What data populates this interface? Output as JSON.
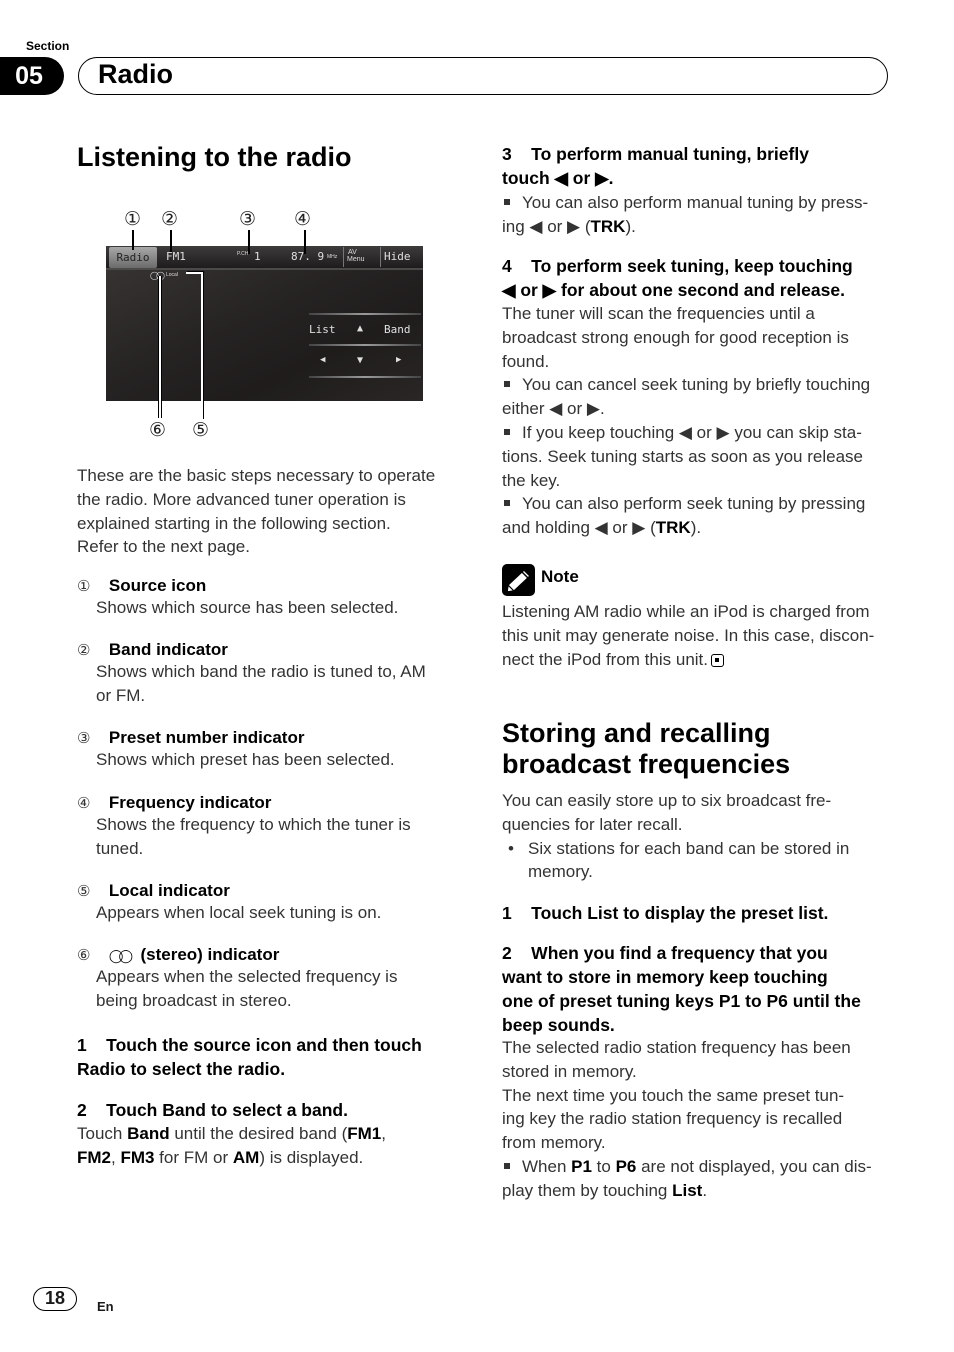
{
  "header": {
    "section_label": "Section",
    "section_number": "05",
    "section_title": "Radio"
  },
  "left": {
    "title": "Listening to the radio",
    "figure": {
      "callouts_top": [
        "①",
        "②",
        "③",
        "④"
      ],
      "callouts_bottom": [
        "⑥",
        "⑤"
      ],
      "screen": {
        "source_button": "Radio",
        "band": "FM1",
        "preset_label": "P.CH",
        "preset_value": "1",
        "frequency": "87. 9",
        "frequency_unit": "MHz",
        "av_menu_line1": "AV",
        "av_menu_line2": "Menu",
        "hide": "Hide",
        "local": "Local",
        "list": "List",
        "up_arrow": "▲",
        "band_button": "Band",
        "left_arrow": "◀",
        "down_arrow": "▼",
        "right_arrow": "▶"
      }
    },
    "intro": [
      "These are the basic steps necessary to operate",
      "the radio. More advanced tuner operation is",
      "explained starting in the following section.",
      "Refer to the next page."
    ],
    "items": [
      {
        "num": "①",
        "head": "Source icon",
        "lines": [
          "Shows which source has been selected."
        ]
      },
      {
        "num": "②",
        "head": "Band indicator",
        "lines": [
          "Shows which band the radio is tuned to, AM",
          "or FM."
        ]
      },
      {
        "num": "③",
        "head": "Preset number indicator",
        "lines": [
          "Shows which preset has been selected."
        ]
      },
      {
        "num": "④",
        "head": "Frequency indicator",
        "lines": [
          "Shows the frequency to which the tuner is",
          "tuned."
        ]
      },
      {
        "num": "⑤",
        "head": "Local indicator",
        "lines": [
          "Appears when local seek tuning is on."
        ]
      },
      {
        "num": "⑥",
        "head": "(stereo) indicator",
        "stereo_glyph": "◯◯",
        "lines": [
          "Appears when the selected frequency is",
          "being broadcast in stereo."
        ]
      }
    ],
    "step1": {
      "line1": "1    Touch the source icon and then touch",
      "line2": "Radio to select the radio."
    },
    "step2": {
      "head": "2    Touch Band to select a band.",
      "t1": "Touch ",
      "b1": "Band",
      "t2": " until the desired band (",
      "b2": "FM1",
      "t3": ",",
      "b3": "FM2",
      "t4": ", ",
      "b4": "FM3",
      "t5": " for FM or ",
      "b5": "AM",
      "t6": ") is displayed."
    }
  },
  "right": {
    "step3": {
      "line1": "3    To perform manual tuning, briefly",
      "line2": "touch ◀ or ▶.",
      "bullet_l1": "You can also perform manual tuning by press-",
      "bullet_l2a": "ing ◀ or ▶ (",
      "bullet_l2b": "TRK",
      "bullet_l2c": ")."
    },
    "step4": {
      "line1": "4    To perform seek tuning, keep touching",
      "line2": "◀ or ▶ for about one second and release.",
      "body": [
        "The tuner will scan the frequencies until a",
        "broadcast strong enough for good reception is",
        "found."
      ],
      "bullets": [
        [
          "You can cancel seek tuning by briefly touching",
          "either ◀ or ▶."
        ],
        [
          "If you keep touching ◀ or ▶ you can skip sta-",
          "tions. Seek tuning starts as soon as you release",
          "the key."
        ]
      ],
      "bullet3_l1": "You can also perform seek tuning by pressing",
      "bullet3_l2a": "and holding ◀ or ▶ (",
      "bullet3_l2b": "TRK",
      "bullet3_l2c": ")."
    },
    "note": {
      "label": "Note",
      "lines": [
        "Listening AM radio while an iPod is charged from",
        "this unit may generate noise. In this case, discon-",
        "nect the iPod from this unit."
      ]
    },
    "section2": {
      "title_l1": "Storing and recalling",
      "title_l2": "broadcast frequencies",
      "intro": [
        "You can easily store up to six broadcast fre-",
        "quencies for later recall."
      ],
      "dot_bullet": [
        "Six stations for each band can be stored in",
        "memory."
      ],
      "step1": "1    Touch List to display the preset list.",
      "step2": [
        "2    When you find a frequency that you",
        "want to store in memory keep touching",
        "one of preset tuning keys P1 to P6 until the",
        "beep sounds."
      ],
      "body": [
        "The selected radio station frequency has been",
        "stored in memory.",
        "The next time you touch the same preset tun-",
        "ing key the radio station frequency is recalled",
        "from memory."
      ],
      "last_bullet": {
        "t1": "When ",
        "b1": "P1",
        "t2": " to ",
        "b2": "P6",
        "t3": " are not displayed, you can dis-",
        "t4": "play them by touching ",
        "b3": "List",
        "t5": "."
      }
    }
  },
  "footer": {
    "page_number": "18",
    "language": "En"
  }
}
